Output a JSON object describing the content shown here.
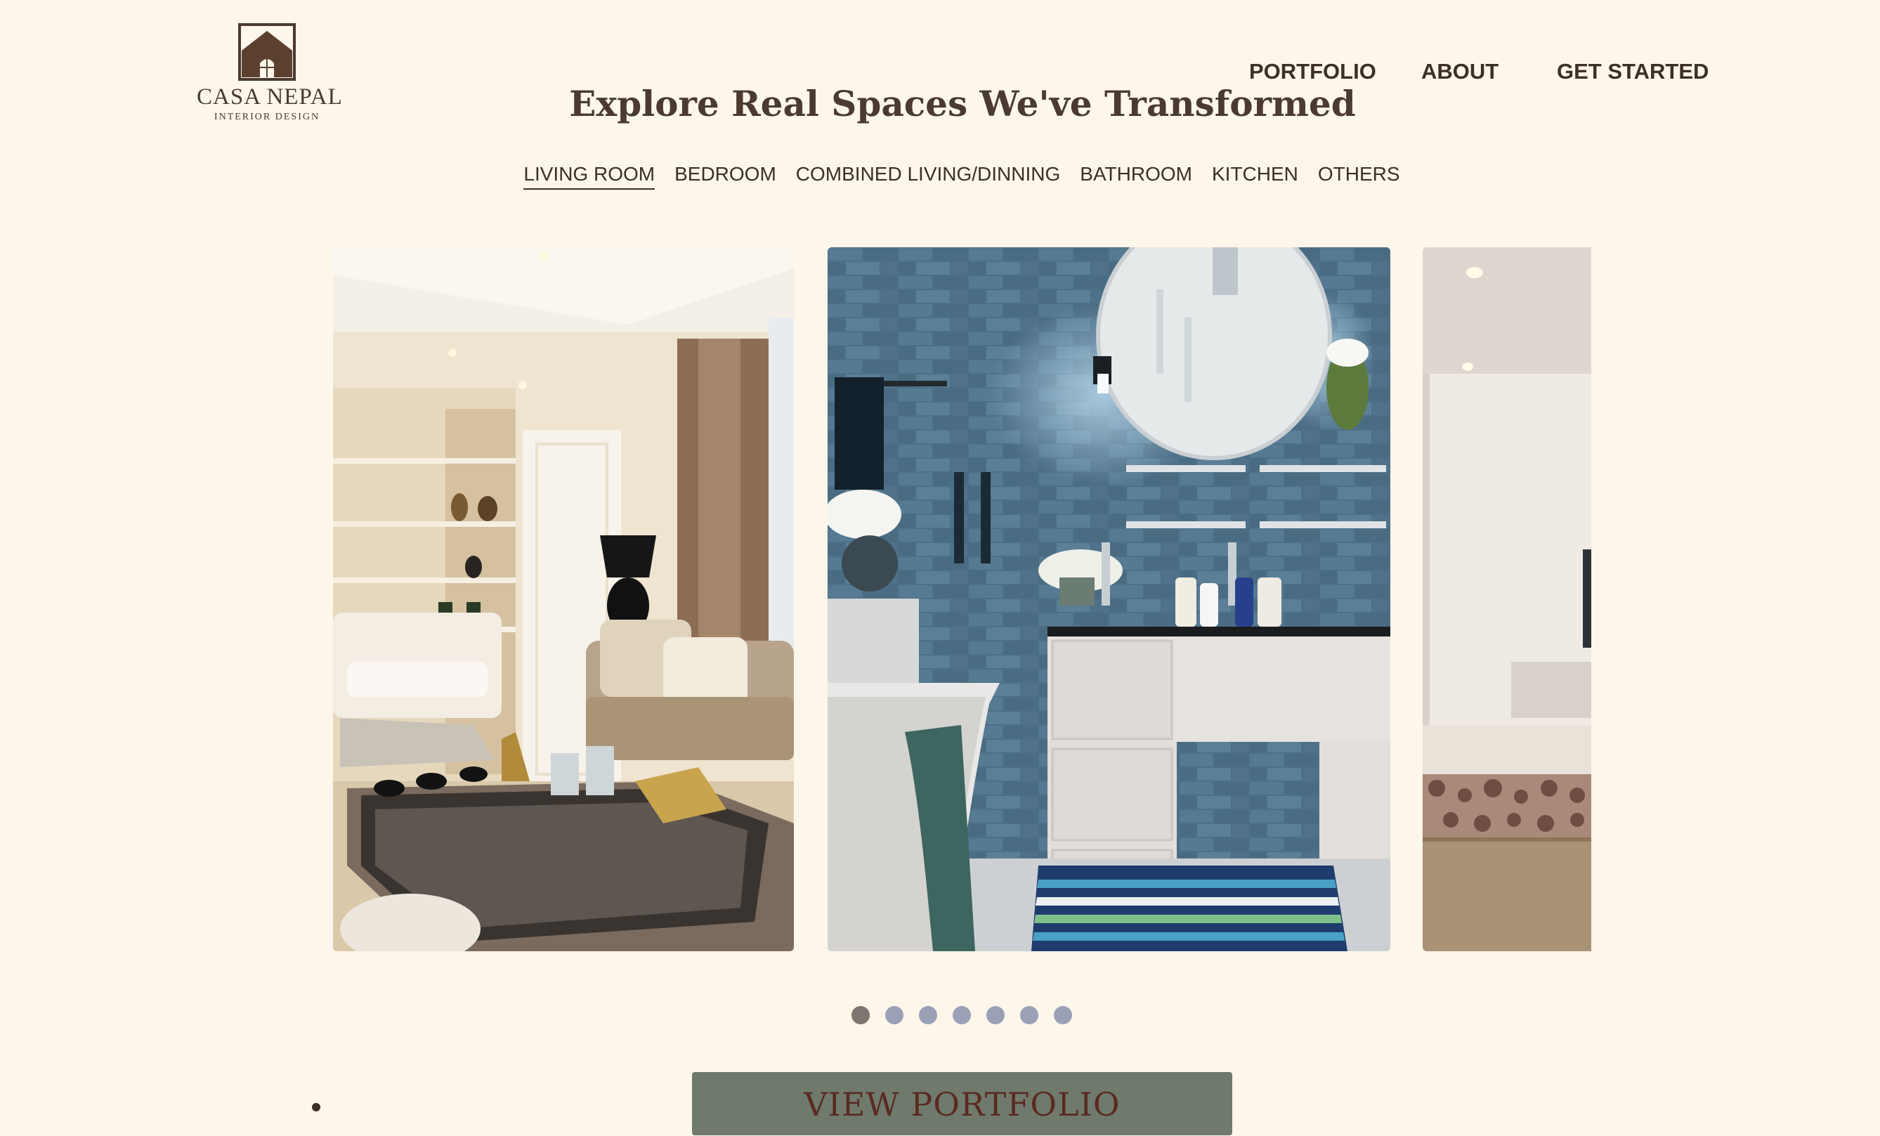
{
  "brand": {
    "name": "CASA NEPAL",
    "tagline": "INTERIOR DESIGN"
  },
  "nav": {
    "items": [
      "PORTFOLIO",
      "ABOUT",
      "GET STARTED"
    ]
  },
  "hero": {
    "title": "Explore Real Spaces We've Transformed"
  },
  "tabs": {
    "items": [
      "LIVING ROOM",
      "BEDROOM",
      "COMBINED LIVING/DINNING",
      "BATHROOM",
      "KITCHEN",
      "OTHERS"
    ],
    "active_index": 0
  },
  "carousel": {
    "slides": [
      {
        "icon": "living-room-photo"
      },
      {
        "icon": "bathroom-photo"
      },
      {
        "icon": "bedroom-photo"
      }
    ],
    "dot_count": 7,
    "active_dot": 0
  },
  "cta": {
    "label": "VIEW PORTFOLIO"
  },
  "colors": {
    "background": "#fdf6ea",
    "text": "#4a3a30",
    "cta_bg": "#6f7a6c",
    "cta_text": "#5a2a22",
    "dot": "#9aa0b6",
    "dot_active": "#7e7570"
  }
}
